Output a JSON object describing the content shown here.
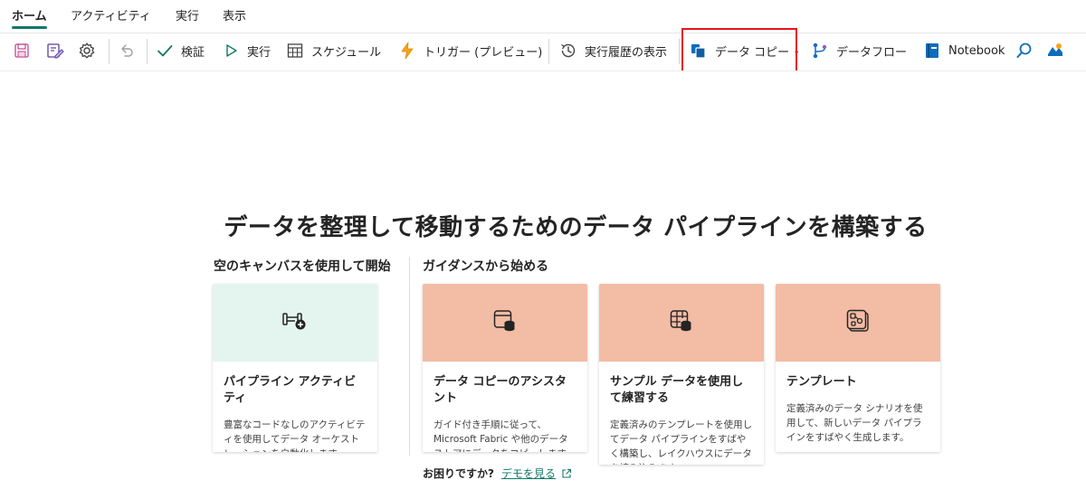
{
  "tabs": [
    {
      "label": "ホーム",
      "active": true
    },
    {
      "label": "アクティビティ",
      "active": false
    },
    {
      "label": "実行",
      "active": false
    },
    {
      "label": "表示",
      "active": false
    }
  ],
  "toolbar": {
    "validate": "検証",
    "run": "実行",
    "schedule": "スケジュール",
    "trigger": "トリガー (プレビュー)",
    "history": "実行履歴の表示",
    "copy_data": "データ コピー",
    "dataflow": "データフロー",
    "notebook": "Notebook"
  },
  "main": {
    "headline": "データを整理して移動するためのデータ パイプラインを構築する",
    "blank_section": "空のキャンバスを使用して開始",
    "guided_section": "ガイダンスから始める",
    "cards": [
      {
        "title": "パイプライン アクティビティ",
        "desc": "豊富なコードなしのアクティビティを使用してデータ オーケストレーションを自動化します。",
        "banner_color": "#e3f5ee",
        "icon": "pipeline-add-icon"
      },
      {
        "title": "データ コピーのアシスタント",
        "desc": "ガイド付き手順に従って、Microsoft Fabric や他のデータ ストアにデータをコピーします。",
        "banner_color": "#f3bca5",
        "icon": "copy-assistant-icon"
      },
      {
        "title": "サンプル データを使用して練習する",
        "desc": "定義済みのテンプレートを使用してデータ パイプラインをすばやく構築し、レイクハウスにデータを読み込みます。",
        "banner_color": "#f3bca5",
        "icon": "sample-data-icon"
      },
      {
        "title": "テンプレート",
        "desc": "定義済みのデータ シナリオを使用して、新しいデータ パイプラインをすばやく生成します。",
        "banner_color": "#f3bca5",
        "icon": "template-icon"
      }
    ],
    "help_question": "お困りですか?",
    "help_link": "デモを見る"
  },
  "colors": {
    "accent": "#117865",
    "highlight": "#e8151b",
    "guided_banner": "#f3bca5",
    "blank_banner": "#e3f5ee"
  }
}
